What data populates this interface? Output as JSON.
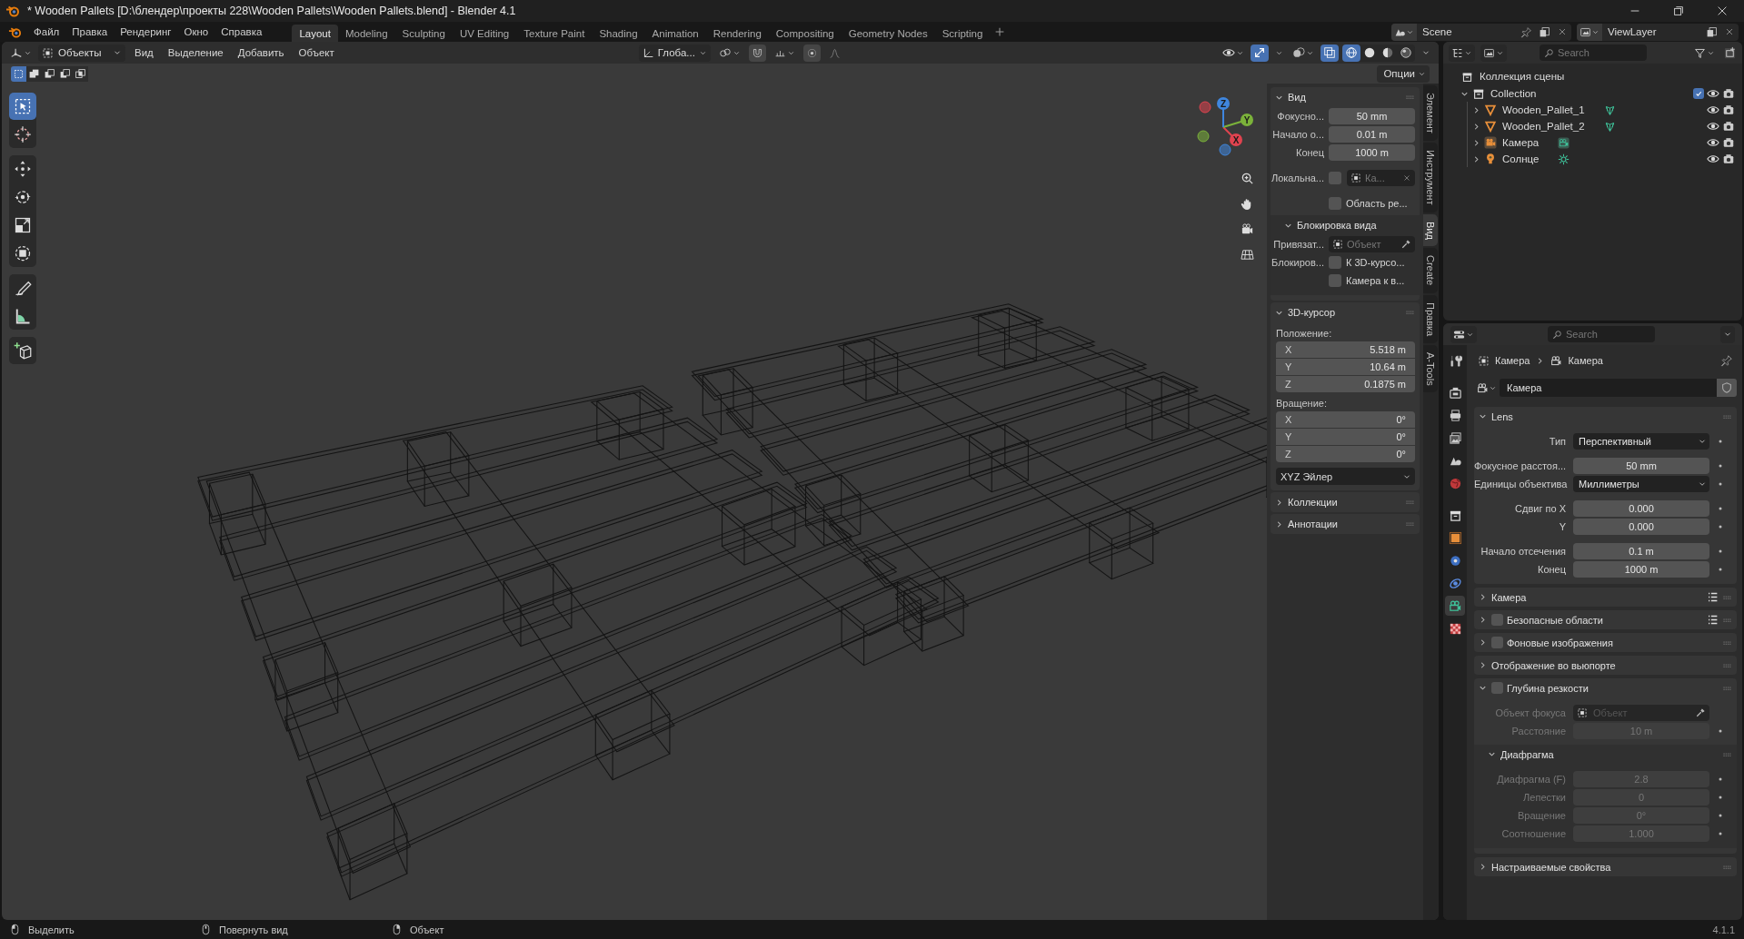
{
  "window": {
    "title": "* Wooden Pallets [D:\\блендер\\проекты 228\\Wooden Pallets\\Wooden Pallets.blend] - Blender 4.1"
  },
  "menu": [
    "Файл",
    "Правка",
    "Рендеринг",
    "Окно",
    "Справка"
  ],
  "workspaces": [
    {
      "label": "Layout",
      "selected": true
    },
    {
      "label": "Modeling",
      "selected": false
    },
    {
      "label": "Sculpting",
      "selected": false
    },
    {
      "label": "UV Editing",
      "selected": false
    },
    {
      "label": "Texture Paint",
      "selected": false
    },
    {
      "label": "Shading",
      "selected": false
    },
    {
      "label": "Animation",
      "selected": false
    },
    {
      "label": "Rendering",
      "selected": false
    },
    {
      "label": "Compositing",
      "selected": false
    },
    {
      "label": "Geometry Nodes",
      "selected": false
    },
    {
      "label": "Scripting",
      "selected": false
    }
  ],
  "scene": "Scene",
  "view_layer": "ViewLayer",
  "viewport": {
    "mode": "Объекты",
    "menus": [
      "Вид",
      "Выделение",
      "Добавить",
      "Объект"
    ],
    "orientation": "Глоба...",
    "options": "Опции",
    "select_modes": [
      {
        "kind": "set",
        "selected": true
      },
      {
        "kind": "extend",
        "selected": false
      },
      {
        "kind": "subtract",
        "selected": false
      },
      {
        "kind": "difference",
        "selected": false
      },
      {
        "kind": "intersect",
        "selected": false
      }
    ],
    "gizmos": {
      "on": true
    },
    "xray": {
      "on": true
    },
    "shading": [
      {
        "kind": "wireframe",
        "selected": true
      },
      {
        "kind": "solid",
        "selected": false
      },
      {
        "kind": "material",
        "selected": false
      },
      {
        "kind": "rendered",
        "selected": false
      }
    ],
    "tools": [
      [
        {
          "kind": "select",
          "selected": true
        },
        {
          "kind": "cursor",
          "selected": false
        }
      ],
      [
        {
          "kind": "move",
          "selected": false
        },
        {
          "kind": "rotate",
          "selected": false
        },
        {
          "kind": "scale",
          "selected": false
        },
        {
          "kind": "transform",
          "selected": false
        }
      ],
      [
        {
          "kind": "annotate",
          "selected": false
        },
        {
          "kind": "measure",
          "selected": false
        }
      ],
      [
        {
          "kind": "add-cube",
          "selected": false
        }
      ]
    ],
    "axes": [
      {
        "label": "X",
        "color": "#e0434f"
      },
      {
        "label": "Y",
        "color": "#7bb23a"
      },
      {
        "label": "Z",
        "color": "#3f86de"
      }
    ]
  },
  "sidebar": {
    "tabs": [
      {
        "label": "Элемент",
        "selected": false
      },
      {
        "label": "Инструмент",
        "selected": false
      },
      {
        "label": "Вид",
        "selected": true
      },
      {
        "label": "Create",
        "selected": false
      },
      {
        "label": "Правка",
        "selected": false
      },
      {
        "label": "A-Tools",
        "selected": false
      }
    ],
    "view": {
      "title": "Вид",
      "expanded": true,
      "fields": [
        {
          "label": "Фокусно...",
          "value": "50 mm"
        },
        {
          "label": "Начало о...",
          "value": "0.01 m"
        },
        {
          "label": "Конец",
          "value": "1000 m"
        }
      ],
      "local_camera": {
        "label": "Локальна...",
        "checked": false,
        "placeholder": "Ка..."
      },
      "render_region": {
        "label": "Область ре...",
        "checked": false
      },
      "lock": {
        "title": "Блокировка вида",
        "expanded": true,
        "object_label": "Привязат...",
        "object_placeholder": "Объект",
        "lock_label": "Блокиров...",
        "options": [
          {
            "label": "К 3D-курсо...",
            "checked": false
          },
          {
            "label": "Камера к в...",
            "checked": false
          }
        ]
      }
    },
    "cursor": {
      "title": "3D-курсор",
      "expanded": true,
      "location_label": "Положение:",
      "location": [
        {
          "axis": "X",
          "value": "5.518 m"
        },
        {
          "axis": "Y",
          "value": "10.64 m"
        },
        {
          "axis": "Z",
          "value": "0.1875 m"
        }
      ],
      "rotation_label": "Вращение:",
      "rotation": [
        {
          "axis": "X",
          "value": "0°"
        },
        {
          "axis": "Y",
          "value": "0°"
        },
        {
          "axis": "Z",
          "value": "0°"
        }
      ],
      "rotation_mode": "XYZ Эйлер"
    },
    "more": [
      {
        "title": "Коллекции",
        "expanded": false
      },
      {
        "title": "Аннотации",
        "expanded": false
      }
    ]
  },
  "outliner": {
    "search": {
      "placeholder": "Search"
    },
    "root": "Коллекция сцены",
    "tree": [
      {
        "name": "Collection",
        "kind": "collection",
        "expanded": true,
        "checked": true,
        "children": [
          {
            "name": "Wooden_Pallet_1",
            "kind": "mesh",
            "expanded": false
          },
          {
            "name": "Wooden_Pallet_2",
            "kind": "mesh",
            "expanded": false
          },
          {
            "name": "Камера",
            "kind": "camera",
            "expanded": false
          },
          {
            "name": "Солнце",
            "kind": "light",
            "expanded": false
          }
        ]
      }
    ]
  },
  "properties": {
    "search": {
      "placeholder": "Search"
    },
    "tabs": [
      {
        "kind": "tool",
        "selected": false
      },
      {
        "kind": "render",
        "selected": false
      },
      {
        "kind": "output",
        "selected": false
      },
      {
        "kind": "view-layer",
        "selected": false
      },
      {
        "kind": "scene",
        "selected": false
      },
      {
        "kind": "world",
        "selected": false
      },
      {
        "kind": "collection",
        "selected": false
      },
      {
        "kind": "object",
        "selected": false
      },
      {
        "kind": "physics",
        "selected": false
      },
      {
        "kind": "constraints",
        "selected": false
      },
      {
        "kind": "camera-data",
        "selected": true
      },
      {
        "kind": "texture",
        "selected": false
      }
    ],
    "breadcrumb": [
      "Камера",
      "Камера"
    ],
    "datablock": "Камера",
    "lens": {
      "title": "Lens",
      "expanded": true,
      "groups": [
        [
          {
            "kind": "dropdown",
            "label": "Тип",
            "value": "Перспективный"
          }
        ],
        [
          {
            "kind": "number",
            "label": "Фокусное расстоя...",
            "value": "50 mm"
          },
          {
            "kind": "dropdown",
            "label": "Единицы объектива",
            "value": "Миллиметры"
          }
        ],
        [
          {
            "kind": "number",
            "label": "Сдвиг по X",
            "value": "0.000"
          },
          {
            "kind": "number",
            "label": "Y",
            "value": "0.000"
          }
        ],
        [
          {
            "kind": "number",
            "label": "Начало отсечения",
            "value": "0.1 m"
          },
          {
            "kind": "number",
            "label": "Конец",
            "value": "1000 m"
          }
        ]
      ]
    },
    "panels": [
      {
        "title": "Камера",
        "expanded": false,
        "presets": true
      },
      {
        "title": "Безопасные области",
        "expanded": false,
        "checked": false,
        "presets": true
      },
      {
        "title": "Фоновые изображения",
        "expanded": false,
        "checked": false
      },
      {
        "title": "Отображение во вьюпорте",
        "expanded": false
      },
      {
        "title": "Глубина резкости",
        "expanded": true,
        "checked": false,
        "rows": [
          {
            "kind": "object",
            "label": "Объект фокуса",
            "placeholder": "Объект"
          },
          {
            "kind": "number",
            "label": "Расстояние",
            "value": "10 m"
          }
        ],
        "subpanel": {
          "title": "Диафрагма",
          "expanded": true,
          "rows": [
            {
              "kind": "number",
              "label": "Диафрагма (F)",
              "value": "2.8"
            },
            {
              "kind": "number",
              "label": "Лепестки",
              "value": "0"
            },
            {
              "kind": "number",
              "label": "Вращение",
              "value": "0°"
            },
            {
              "kind": "number",
              "label": "Соотношение",
              "value": "1.000"
            }
          ]
        }
      },
      {
        "title": "Настраиваемые свойства",
        "expanded": false
      }
    ]
  },
  "status_bar": {
    "hints": [
      {
        "kind": "mouse-left",
        "label": "Выделить"
      },
      {
        "kind": "mouse-middle",
        "label": "Повернуть вид"
      },
      {
        "kind": "mouse-right",
        "label": "Объект"
      }
    ],
    "version": "4.1.1"
  }
}
